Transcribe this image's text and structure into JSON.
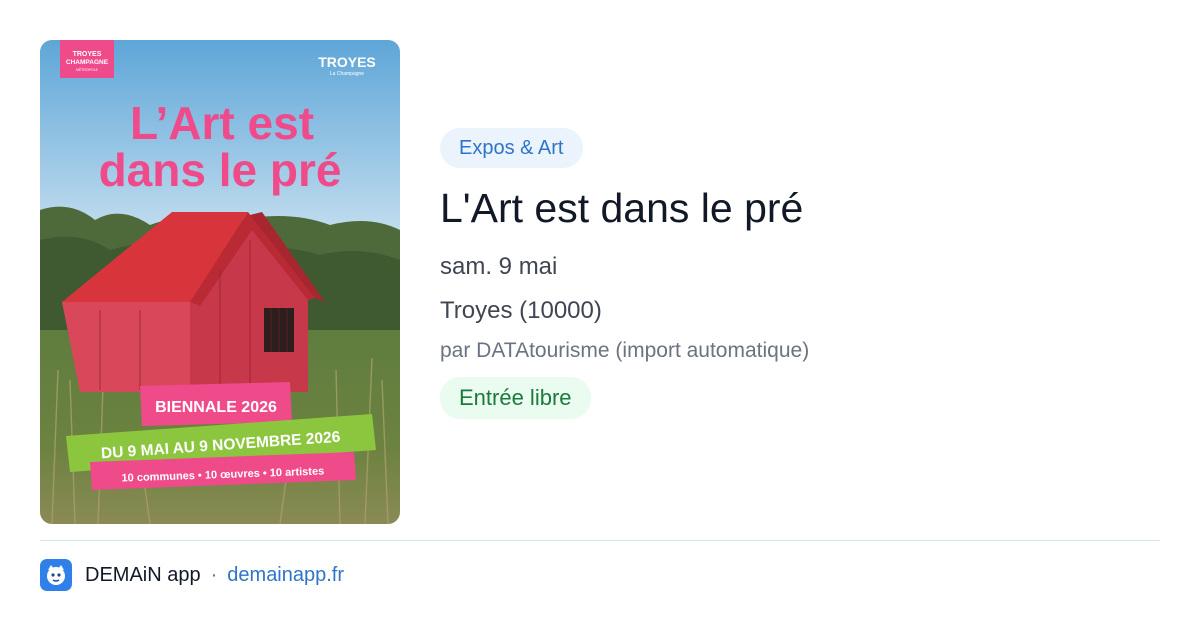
{
  "poster": {
    "logo_left": [
      "TROYES",
      "CHAMPAGNE",
      "MÉTROPOLE"
    ],
    "logo_right": [
      "TROYES",
      "La Champagne"
    ],
    "headline_line1": "L’Art est",
    "headline_line2": "dans le pré",
    "banner_1": "BIENNALE 2026",
    "banner_2": "DU 9 MAI AU 9 NOVEMBRE 2026",
    "banner_3": "10 communes  •  10 œuvres  •  10 artistes",
    "colors": {
      "pink": "#ef4b8b",
      "green": "#8cc63f",
      "roof_red": "#d8343c",
      "sky": "#9ccbe8"
    }
  },
  "event": {
    "category": "Expos & Art",
    "title": "L'Art est dans le pré",
    "date": "sam. 9 mai",
    "location": "Troyes (10000)",
    "source": "par DATAtourisme (import automatique)",
    "price": "Entrée libre"
  },
  "footer": {
    "app_name": "DEMAiN app",
    "separator": "·",
    "domain": "demainapp.fr",
    "icon": "demain-app-icon"
  }
}
